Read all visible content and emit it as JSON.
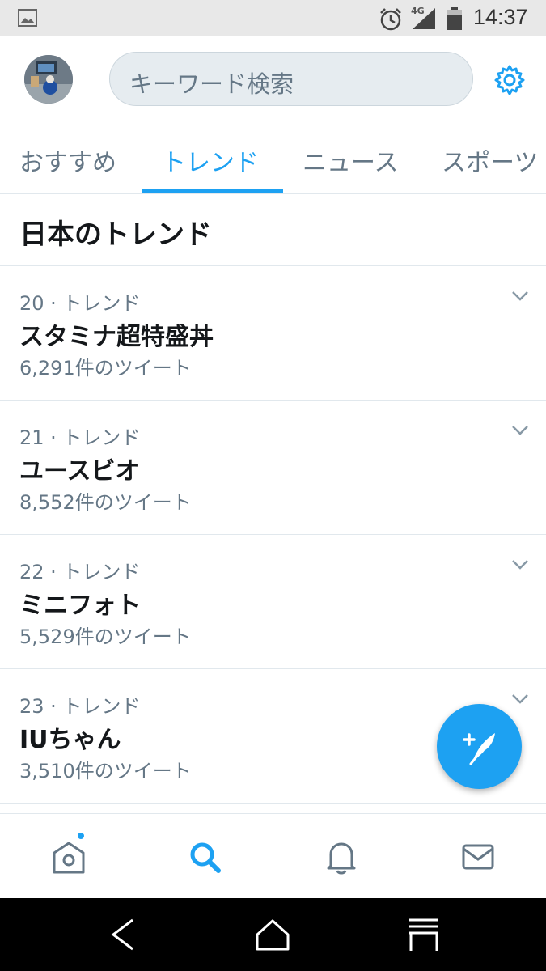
{
  "status_bar": {
    "network": "4G",
    "time": "14:37",
    "icons": [
      "image-notification-icon",
      "alarm-icon",
      "signal-icon",
      "battery-icon"
    ]
  },
  "header": {
    "search_placeholder": "キーワード検索",
    "icons": [
      "avatar",
      "settings-gear-icon"
    ]
  },
  "tabs": [
    {
      "label": "おすすめ",
      "active": false
    },
    {
      "label": "トレンド",
      "active": true
    },
    {
      "label": "ニュース",
      "active": false
    },
    {
      "label": "スポーツ",
      "active": false
    }
  ],
  "section": {
    "title": "日本のトレンド"
  },
  "trends": [
    {
      "meta": "20 · トレンド",
      "name": "スタミナ超特盛丼",
      "count": "6,291件のツイート"
    },
    {
      "meta": "21 · トレンド",
      "name": "ユースビオ",
      "count": "8,552件のツイート"
    },
    {
      "meta": "22 · トレンド",
      "name": "ミニフォト",
      "count": "5,529件のツイート"
    },
    {
      "meta": "23 · トレンド",
      "name": "IUちゃん",
      "count": "3,510件のツイート"
    }
  ],
  "bottom_nav": [
    {
      "icon": "home-icon",
      "active": false,
      "has_notification_dot": true
    },
    {
      "icon": "search-icon",
      "active": true
    },
    {
      "icon": "notifications-bell-icon",
      "active": false
    },
    {
      "icon": "messages-envelope-icon",
      "active": false
    }
  ],
  "fab": {
    "icon": "compose-tweet-icon"
  },
  "system_nav": [
    "back-icon",
    "home-system-icon",
    "recents-icon"
  ],
  "colors": {
    "accent": "#1da1f2",
    "text_primary": "#14171a",
    "text_secondary": "#657786",
    "divider": "#e1e8ed",
    "search_bg": "#e6ecf0"
  }
}
